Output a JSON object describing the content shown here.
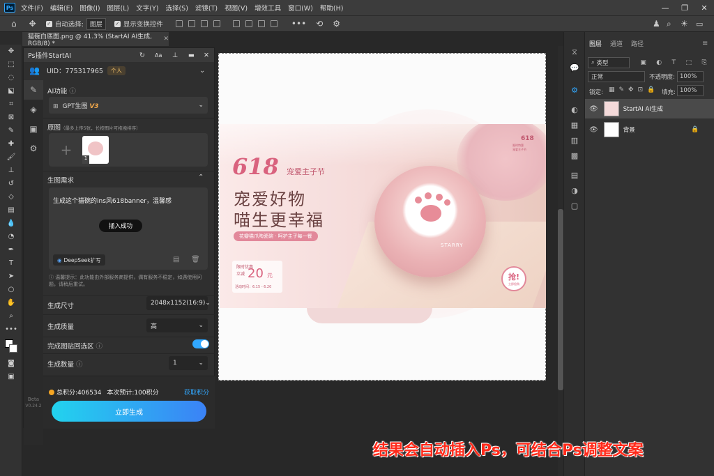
{
  "menubar": {
    "items": [
      "文件(F)",
      "编辑(E)",
      "图像(I)",
      "图层(L)",
      "文字(Y)",
      "选择(S)",
      "滤镜(T)",
      "视图(V)",
      "增效工具",
      "窗口(W)",
      "帮助(H)"
    ]
  },
  "options": {
    "auto_select": "自动选择:",
    "auto_select_value": "图层",
    "show_transform": "显示变换控件"
  },
  "document": {
    "tab_title": "猫碗白底图.png @ 41.3% (StartAI AI生成, RGB/8) *"
  },
  "plugin": {
    "title": "Ps插件StartAI",
    "uid": "UID：775317965",
    "plan_badge": "个人",
    "ai_function_label": "AI功能",
    "model_value": "GPT生图",
    "model_version": "V3",
    "source_label": "原图",
    "source_hint": "（最多上传5张，长按图片可拖拽排序）",
    "source_count": "1",
    "requirement_label": "生图需求",
    "prompt_text": "生成这个猫碗的ins风618banner，温馨感",
    "toast": "插入成功",
    "deepseek_label": "DeepSeek扩写",
    "notice": "温馨提示：此功能由外部服务商提供，偶有服务不稳定，如遇使用问题，请稍后重试。",
    "size_label": "生成尺寸",
    "size_value": "2048x1152(16:9)",
    "quality_label": "生成质量",
    "quality_value": "高",
    "paste_label": "完成图贴回选区",
    "count_label": "生成数量",
    "count_value": "1",
    "points_total": "总积分:406534",
    "points_estimate": "本次预计:100积分",
    "get_points": "获取积分",
    "generate_button": "立即生成",
    "beta_label": "Beta",
    "version_label": "V0.24.2"
  },
  "banner": {
    "big_number": "618",
    "festival": "宠爱主子节",
    "headline1": "宠爱好物",
    "headline2": "喵生更幸福",
    "ribbon": "花瓣猫爪陶瓷碗 · 呵护主子每一餐",
    "price_tag": "限时优惠",
    "price_prefix": "立减",
    "price_value": "20",
    "price_unit": "元",
    "date_range": "活动时间：6.15 - 6.20",
    "grab_badge": "抢!",
    "grab_sub": "立即抢购",
    "corner_number": "618",
    "corner_line1": "限时特惠",
    "corner_line2": "宠爱主子节",
    "bowl_text": "STARRY"
  },
  "layers_panel": {
    "tabs": [
      "图层",
      "通道",
      "路径"
    ],
    "filter_kind": "类型",
    "blend_mode": "正常",
    "opacity_label": "不透明度:",
    "opacity_value": "100%",
    "lock_label": "锁定:",
    "fill_label": "填充:",
    "fill_value": "100%",
    "layers": [
      {
        "name": "StartAI AI生成"
      },
      {
        "name": "背景"
      }
    ]
  },
  "caption": "结果会自动插入Ps，可结合Ps调整文案",
  "colors": {
    "accent_blue": "#31a8ff",
    "generate_gradient_start": "#22d3ee",
    "generate_gradient_end": "#3b82f6",
    "caption_red": "#ff2a1a",
    "banner_pink": "#d9627e"
  }
}
